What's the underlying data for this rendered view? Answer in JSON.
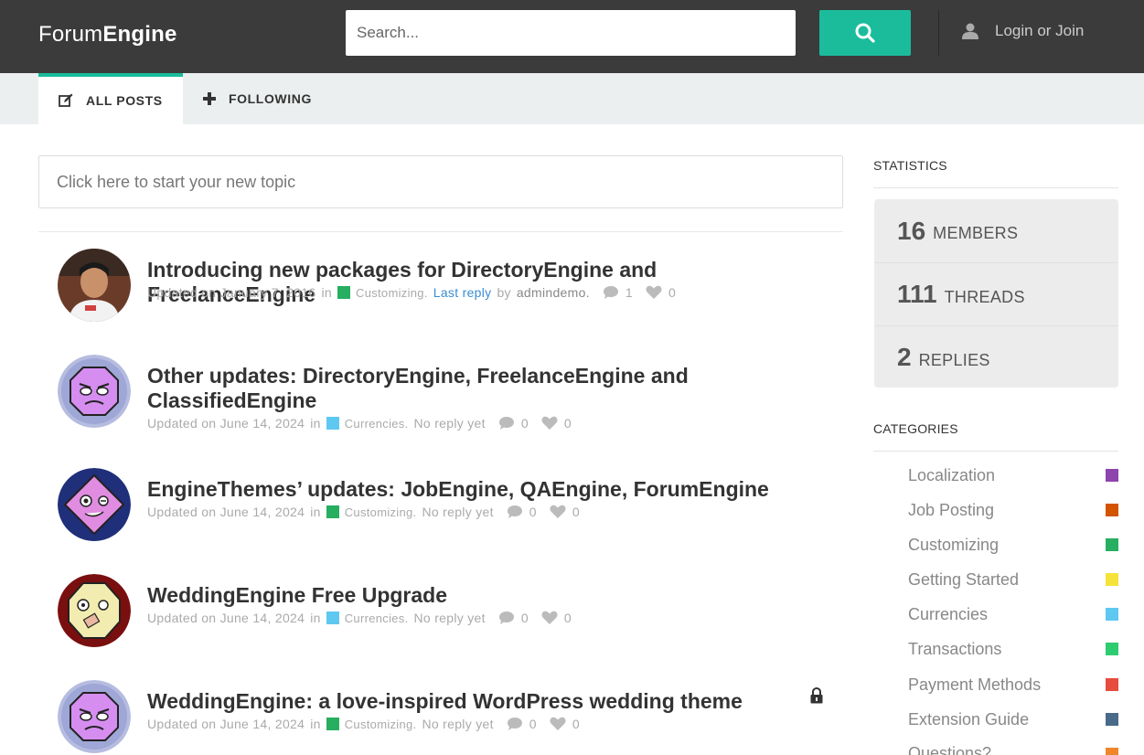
{
  "header": {
    "logo_light": "Forum",
    "logo_bold": "Engine",
    "search_placeholder": "Search...",
    "login_label": "Login or Join"
  },
  "tabs": [
    {
      "label": "ALL POSTS",
      "icon": "edit-icon",
      "active": true
    },
    {
      "label": "FOLLOWING",
      "icon": "plus-icon",
      "active": false
    }
  ],
  "new_topic_placeholder": "Click here to start your new topic",
  "posts": [
    {
      "title": "Introducing new packages for DirectoryEngine and FreelanceEngine",
      "updated": "Updated on January 7, 2016",
      "in": "in",
      "category": "Customizing.",
      "category_color": "#27ae60",
      "reply_text": "Last reply",
      "by": "by",
      "author": "admindemo.",
      "comments": "1",
      "likes": "0",
      "locked": false
    },
    {
      "title": "Other updates: DirectoryEngine, FreelanceEngine and ClassifiedEngine",
      "updated": "Updated on June 14, 2024",
      "in": "in",
      "category": "Currencies.",
      "category_color": "#5ec8f0",
      "reply_text": "No reply yet",
      "comments": "0",
      "likes": "0",
      "locked": false
    },
    {
      "title": "EngineThemes’ updates: JobEngine, QAEngine, ForumEngine",
      "updated": "Updated on June 14, 2024",
      "in": "in",
      "category": "Customizing.",
      "category_color": "#27ae60",
      "reply_text": "No reply yet",
      "comments": "0",
      "likes": "0",
      "locked": false
    },
    {
      "title": "WeddingEngine Free Upgrade",
      "updated": "Updated on June 14, 2024",
      "in": "in",
      "category": "Currencies.",
      "category_color": "#5ec8f0",
      "reply_text": "No reply yet",
      "comments": "0",
      "likes": "0",
      "locked": false
    },
    {
      "title": "WeddingEngine: a love-inspired WordPress wedding theme",
      "updated": "Updated on June 14, 2024",
      "in": "in",
      "category": "Customizing.",
      "category_color": "#27ae60",
      "reply_text": "No reply yet",
      "comments": "0",
      "likes": "0",
      "locked": true
    }
  ],
  "sidebar": {
    "statistics_heading": "STATISTICS",
    "stats": [
      {
        "num": "16",
        "label": "MEMBERS"
      },
      {
        "num": "111",
        "label": "THREADS"
      },
      {
        "num": "2",
        "label": "REPLIES"
      }
    ],
    "categories_heading": "CATEGORIES",
    "categories": [
      {
        "name": "Localization",
        "color": "#8e44ad"
      },
      {
        "name": "Job Posting",
        "color": "#d35400"
      },
      {
        "name": "Customizing",
        "color": "#27ae60"
      },
      {
        "name": "Getting Started",
        "color": "#f5e33a"
      },
      {
        "name": "Currencies",
        "color": "#5ec8f0"
      },
      {
        "name": "Transactions",
        "color": "#2ecc71"
      },
      {
        "name": "Payment Methods",
        "color": "#e74c3c"
      },
      {
        "name": "Extension Guide",
        "color": "#4a6a8a"
      },
      {
        "name": "Questions?",
        "color": "#f0862a"
      }
    ]
  }
}
